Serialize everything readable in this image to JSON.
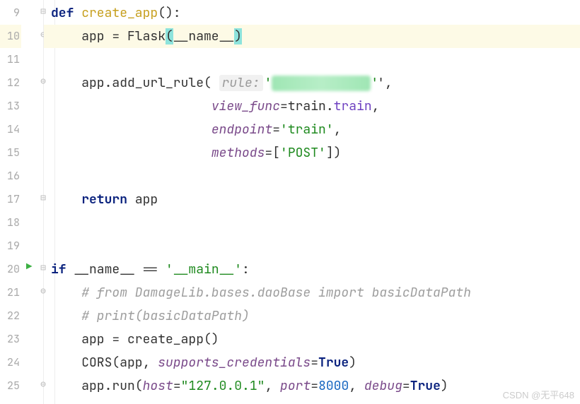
{
  "gutter": {
    "start": 9,
    "end": 25,
    "highlighted_line": 10,
    "run_marker_line": 20,
    "fold_open_lines": [
      9,
      20
    ],
    "fold_close_lines": [
      10,
      12,
      17,
      21,
      25
    ]
  },
  "code": {
    "l9": {
      "kw": "def ",
      "fn": "create_app",
      "rest": "():"
    },
    "l10": {
      "pre": "    app = ",
      "flask": "Flask",
      "open": "(",
      "dunder": "__name__",
      "close": ")"
    },
    "l11": "",
    "l12": {
      "pre": "    app.add_url_rule( ",
      "hint": "rule:",
      "strq": "'",
      "tail": "',"
    },
    "l13": {
      "pad": "                     ",
      "kw": "view_func",
      "eq": "=",
      "mod": "train",
      "dot": ".",
      "attr": "train",
      "tail": ","
    },
    "l14": {
      "pad": "                     ",
      "kw": "endpoint",
      "eq": "=",
      "str": "'train'",
      "tail": ","
    },
    "l15": {
      "pad": "                     ",
      "kw": "methods",
      "eq": "=[",
      "str": "'POST'",
      "tail": "])"
    },
    "l16": "",
    "l17": {
      "pad": "    ",
      "ret": "return ",
      "id": "app"
    },
    "l18": "",
    "l19": "",
    "l20": {
      "if": "if ",
      "dunder": "__name__",
      "eq": " == ",
      "str": "'__main__'",
      "tail": ":"
    },
    "l21": {
      "pad": "    ",
      "com": "# from DamageLib.bases.daoBase import basicDataPath"
    },
    "l22": {
      "pad": "    ",
      "com": "# print(basicDataPath)"
    },
    "l23": {
      "pad": "    app = ",
      "fn": "create_app",
      "tail": "()"
    },
    "l24": {
      "pad": "    ",
      "fn": "CORS",
      "open": "(app, ",
      "kw": "supports_credentials",
      "eq": "=",
      "true": "True",
      "close": ")"
    },
    "l25": {
      "pad": "    app.run(",
      "k1": "host",
      "v1": "\"127.0.0.1\"",
      "sep1": ", ",
      "k2": "port",
      "v2": "8000",
      "sep2": ", ",
      "k3": "debug",
      "v3": "True",
      "close": ")"
    }
  },
  "watermark": "CSDN @无平648"
}
